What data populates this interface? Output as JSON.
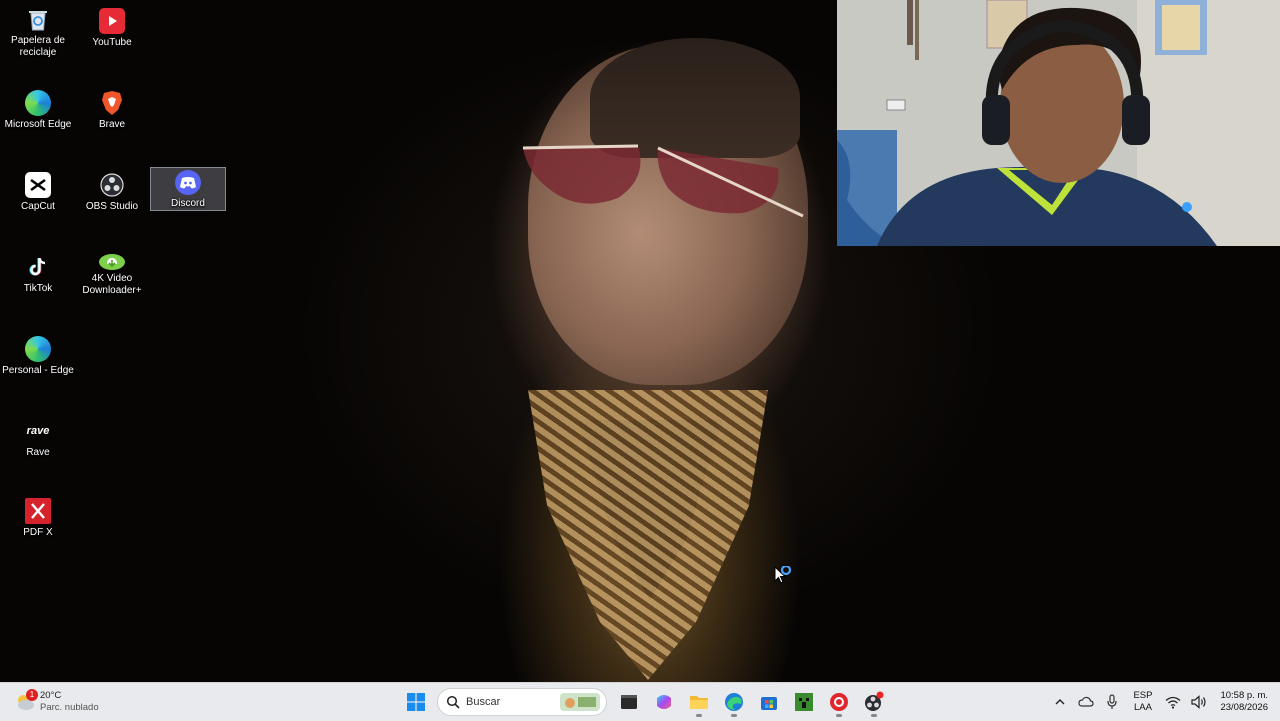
{
  "desktop": {
    "icons": [
      {
        "label": "Papelera de\nreciclaje",
        "icon": "recycle-bin-icon"
      },
      {
        "label": "YouTube",
        "icon": "youtube-icon"
      },
      {
        "label": "Microsoft Edge",
        "icon": "edge-icon"
      },
      {
        "label": "Brave",
        "icon": "brave-icon"
      },
      {
        "label": "CapCut",
        "icon": "capcut-icon"
      },
      {
        "label": "OBS Studio",
        "icon": "obs-icon"
      },
      {
        "label": "Discord",
        "icon": "discord-icon"
      },
      {
        "label": "TikTok",
        "icon": "tiktok-icon"
      },
      {
        "label": "4K Video\nDownloader+",
        "icon": "4k-downloader-icon"
      },
      {
        "label": "Personal - Edge",
        "icon": "edge-profile-icon"
      },
      {
        "label": "Rave",
        "icon": "rave-icon"
      },
      {
        "label": "PDF X",
        "icon": "pdfx-icon"
      }
    ],
    "selected": "Discord"
  },
  "taskbar": {
    "weather": {
      "temp": "20°C",
      "condition": "Parc. nublado",
      "badge": "1"
    },
    "search_placeholder": "Buscar",
    "apps": [
      "start-icon",
      "search-icon",
      "explorer-widget-icon",
      "terminal-icon",
      "m365-icon",
      "file-explorer-icon",
      "edge-icon",
      "store-icon",
      "minecraft-icon",
      "obs-red-icon",
      "obs-record-icon"
    ],
    "tray": {
      "lang_top": "ESP",
      "lang_bottom": "LAA",
      "time": "10:58 p. m.",
      "date": "23/08/2026"
    }
  },
  "colors": {
    "taskbar_bg": "#e9eaed",
    "accent": "#0078d4"
  }
}
